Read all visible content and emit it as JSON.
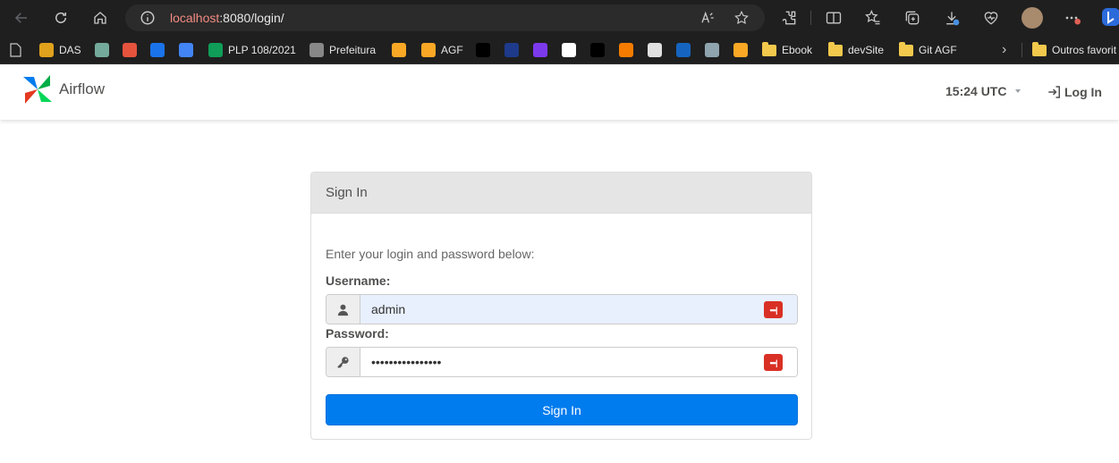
{
  "browser": {
    "url_host": "localhost",
    "url_path": ":8080/login/",
    "bookmarks": [
      {
        "label": "DAS",
        "color": "#e0a21c"
      },
      {
        "label": "",
        "color": "#74aa9c"
      },
      {
        "label": "",
        "color": "#e5533d"
      },
      {
        "label": "",
        "color": "#1a73e8"
      },
      {
        "label": "",
        "color": "#4285f4"
      },
      {
        "label": "PLP 108/2021",
        "color": "#0f9d58"
      },
      {
        "label": "Prefeitura",
        "color": "#888888"
      },
      {
        "label": "",
        "color": "#f9a825"
      },
      {
        "label": "AGF",
        "color": "#f9a825"
      },
      {
        "label": "",
        "color": "#000000"
      },
      {
        "label": "",
        "color": "#1e3a8a"
      },
      {
        "label": "",
        "color": "#7c3aed"
      },
      {
        "label": "",
        "color": "#ffffff"
      },
      {
        "label": "",
        "color": "#000000"
      },
      {
        "label": "",
        "color": "#f57c00"
      },
      {
        "label": "",
        "color": "#e0e0e0"
      },
      {
        "label": "",
        "color": "#1565c0"
      },
      {
        "label": "",
        "color": "#90a4ae"
      },
      {
        "label": "",
        "color": "#f9a825"
      }
    ],
    "folders": [
      "Ebook",
      "devSite",
      "Git AGF"
    ],
    "overflow_folder": "Outros favorit"
  },
  "app": {
    "name": "Airflow",
    "clock": "15:24 UTC",
    "login_label": "Log In"
  },
  "panel": {
    "title": "Sign In",
    "hint": "Enter your login and password below:",
    "username_label": "Username:",
    "username_value": "admin",
    "password_label": "Password:",
    "password_value": "••••••••••••••••",
    "submit_label": "Sign In",
    "password_manager_badge": "•••|"
  },
  "colors": {
    "primary": "#017cee",
    "autofill": "#e8f0fe",
    "badge": "#d93025"
  }
}
